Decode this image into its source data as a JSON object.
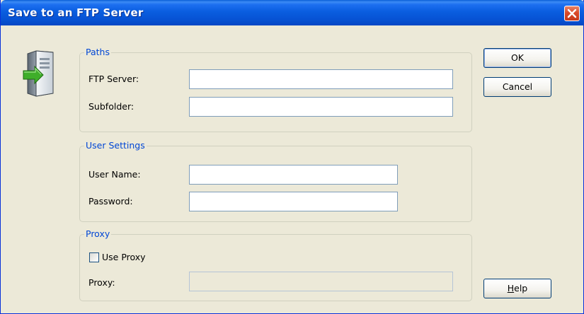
{
  "window": {
    "title": "Save to an FTP Server"
  },
  "icons": {
    "server": "server-upload-icon",
    "close": "close-icon"
  },
  "paths": {
    "legend": "Paths",
    "ftp_server_label": "FTP Server:",
    "ftp_server_value": "",
    "subfolder_label": "Subfolder:",
    "subfolder_value": ""
  },
  "user_settings": {
    "legend": "User Settings",
    "user_name_label": "User Name:",
    "user_name_value": "",
    "password_label": "Password:",
    "password_value": ""
  },
  "proxy": {
    "legend": "Proxy",
    "use_proxy_label": "Use Proxy",
    "use_proxy_checked": false,
    "proxy_label": "Proxy:",
    "proxy_value": ""
  },
  "buttons": {
    "ok": "OK",
    "cancel": "Cancel",
    "help_first": "H",
    "help_rest": "elp"
  },
  "colors": {
    "titlebar": "#0a5ee0",
    "group_label": "#0046d5",
    "dialog_bg": "#ece9d8",
    "close": "#d94a2a"
  }
}
